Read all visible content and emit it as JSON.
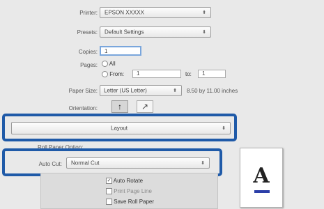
{
  "printer": {
    "label": "Printer:",
    "value": "EPSON XXXXX"
  },
  "presets": {
    "label": "Presets:",
    "value": "Default Settings"
  },
  "copies": {
    "label": "Copies:",
    "value": "1"
  },
  "pages": {
    "label": "Pages:",
    "all_label": "All",
    "from_label": "From:",
    "from_value": "1",
    "to_label": "to:",
    "to_value": "1"
  },
  "paper_size": {
    "label": "Paper Size:",
    "value": "Letter (US Letter)",
    "dimensions": "8.50 by 11.00 inches"
  },
  "orientation": {
    "label": "Orientation:",
    "portrait_glyph": "↑",
    "landscape_glyph": "↗"
  },
  "panel_menu": {
    "value": "Layout"
  },
  "roll_paper_option": {
    "title": "Roll Paper Option:",
    "auto_cut_label": "Auto Cut:",
    "auto_cut_value": "Normal Cut"
  },
  "checkboxes": {
    "auto_rotate": "Auto Rotate",
    "print_page_line": "Print Page Line",
    "save_roll_paper": "Save Roll Paper"
  },
  "preview": {
    "letter": "A"
  },
  "icons": {
    "popup_arrows": "updown-arrows-icon"
  }
}
